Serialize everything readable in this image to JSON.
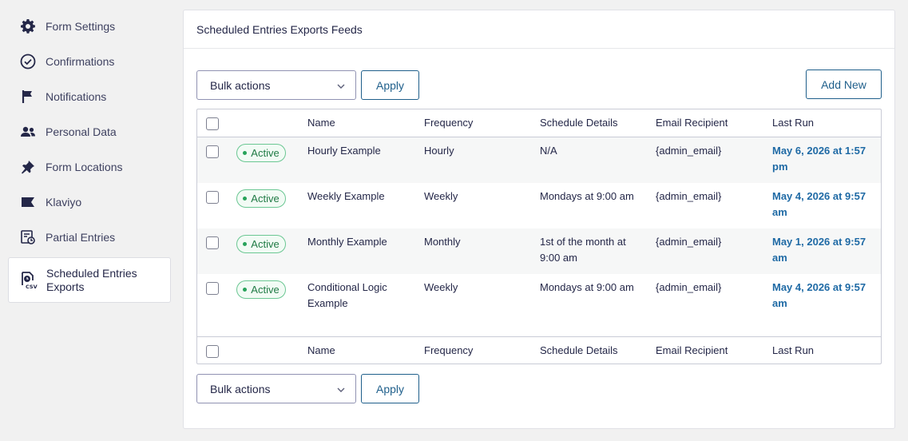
{
  "sidebar": {
    "items": [
      {
        "label": "Form Settings",
        "icon": "gear-icon"
      },
      {
        "label": "Confirmations",
        "icon": "check-circle-icon"
      },
      {
        "label": "Notifications",
        "icon": "flag-icon"
      },
      {
        "label": "Personal Data",
        "icon": "users-icon"
      },
      {
        "label": "Form Locations",
        "icon": "pin-icon"
      },
      {
        "label": "Klaviyo",
        "icon": "klaviyo-icon"
      },
      {
        "label": "Partial Entries",
        "icon": "partial-entries-icon"
      },
      {
        "label": "Scheduled Entries Exports",
        "icon": "csv-export-icon",
        "active": true
      }
    ]
  },
  "panel": {
    "title": "Scheduled Entries Exports Feeds",
    "bulk_actions": "Bulk actions",
    "apply": "Apply",
    "add_new": "Add New"
  },
  "table": {
    "columns": [
      "Name",
      "Frequency",
      "Schedule Details",
      "Email Recipient",
      "Last Run"
    ],
    "rows": [
      {
        "status": "Active",
        "name": "Hourly Example",
        "frequency": "Hourly",
        "schedule": "N/A",
        "recipient": "{admin_email}",
        "last_run": "May 6, 2026 at 1:57 pm"
      },
      {
        "status": "Active",
        "name": "Weekly Example",
        "frequency": "Weekly",
        "schedule": "Mondays at 9:00 am",
        "recipient": "{admin_email}",
        "last_run": "May 4, 2026 at 9:57 am"
      },
      {
        "status": "Active",
        "name": "Monthly Example",
        "frequency": "Monthly",
        "schedule": "1st of the month at 9:00 am",
        "recipient": "{admin_email}",
        "last_run": "May 1, 2026 at 9:57 am"
      },
      {
        "status": "Active",
        "name": "Conditional Logic Example",
        "frequency": "Weekly",
        "schedule": "Mondays at 9:00 am",
        "recipient": "{admin_email}",
        "last_run": "May 4, 2026 at 9:57 am"
      }
    ]
  },
  "colors": {
    "accent": "#1f5f8b",
    "link": "#1f6aa5",
    "active_badge": "#27a35a"
  }
}
